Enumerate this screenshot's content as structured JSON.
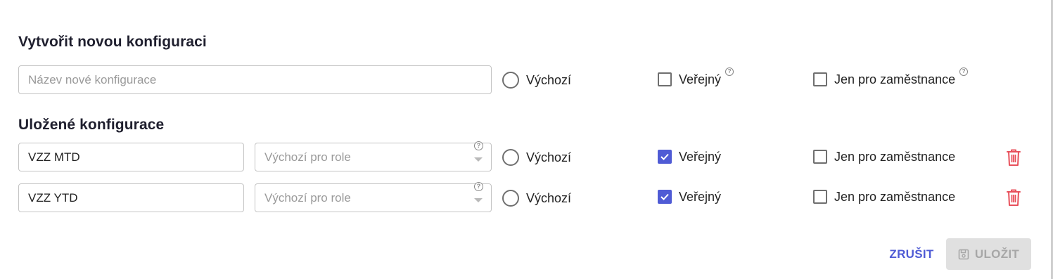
{
  "new_config": {
    "title": "Vytvořit novou konfiguraci",
    "name_placeholder": "Název nové konfigurace",
    "default_label": "Výchozí",
    "public_label": "Veřejný",
    "employees_label": "Jen pro zaměstnance",
    "help_glyph": "?"
  },
  "saved": {
    "title": "Uložené konfigurace",
    "rows": [
      {
        "name": "VZZ MTD",
        "roles_placeholder": "Výchozí pro role",
        "default_label": "Výchozí",
        "default_selected": false,
        "public_label": "Veřejný",
        "public_checked": true,
        "employees_label": "Jen pro zaměstnance",
        "employees_checked": false
      },
      {
        "name": "VZZ YTD",
        "roles_placeholder": "Výchozí pro role",
        "default_label": "Výchozí",
        "default_selected": false,
        "public_label": "Veřejný",
        "public_checked": true,
        "employees_label": "Jen pro zaměstnance",
        "employees_checked": false
      }
    ]
  },
  "actions": {
    "cancel_label": "ZRUŠIT",
    "save_label": "ULOŽIT"
  },
  "icons": {
    "delete": "trash-icon",
    "save": "floppy-disk-icon",
    "help": "help-circle-icon"
  },
  "colors": {
    "accent": "#4f5bd5",
    "danger": "#e8505b",
    "disabled_bg": "#e0e0e0",
    "disabled_text": "#a7a7a7"
  }
}
